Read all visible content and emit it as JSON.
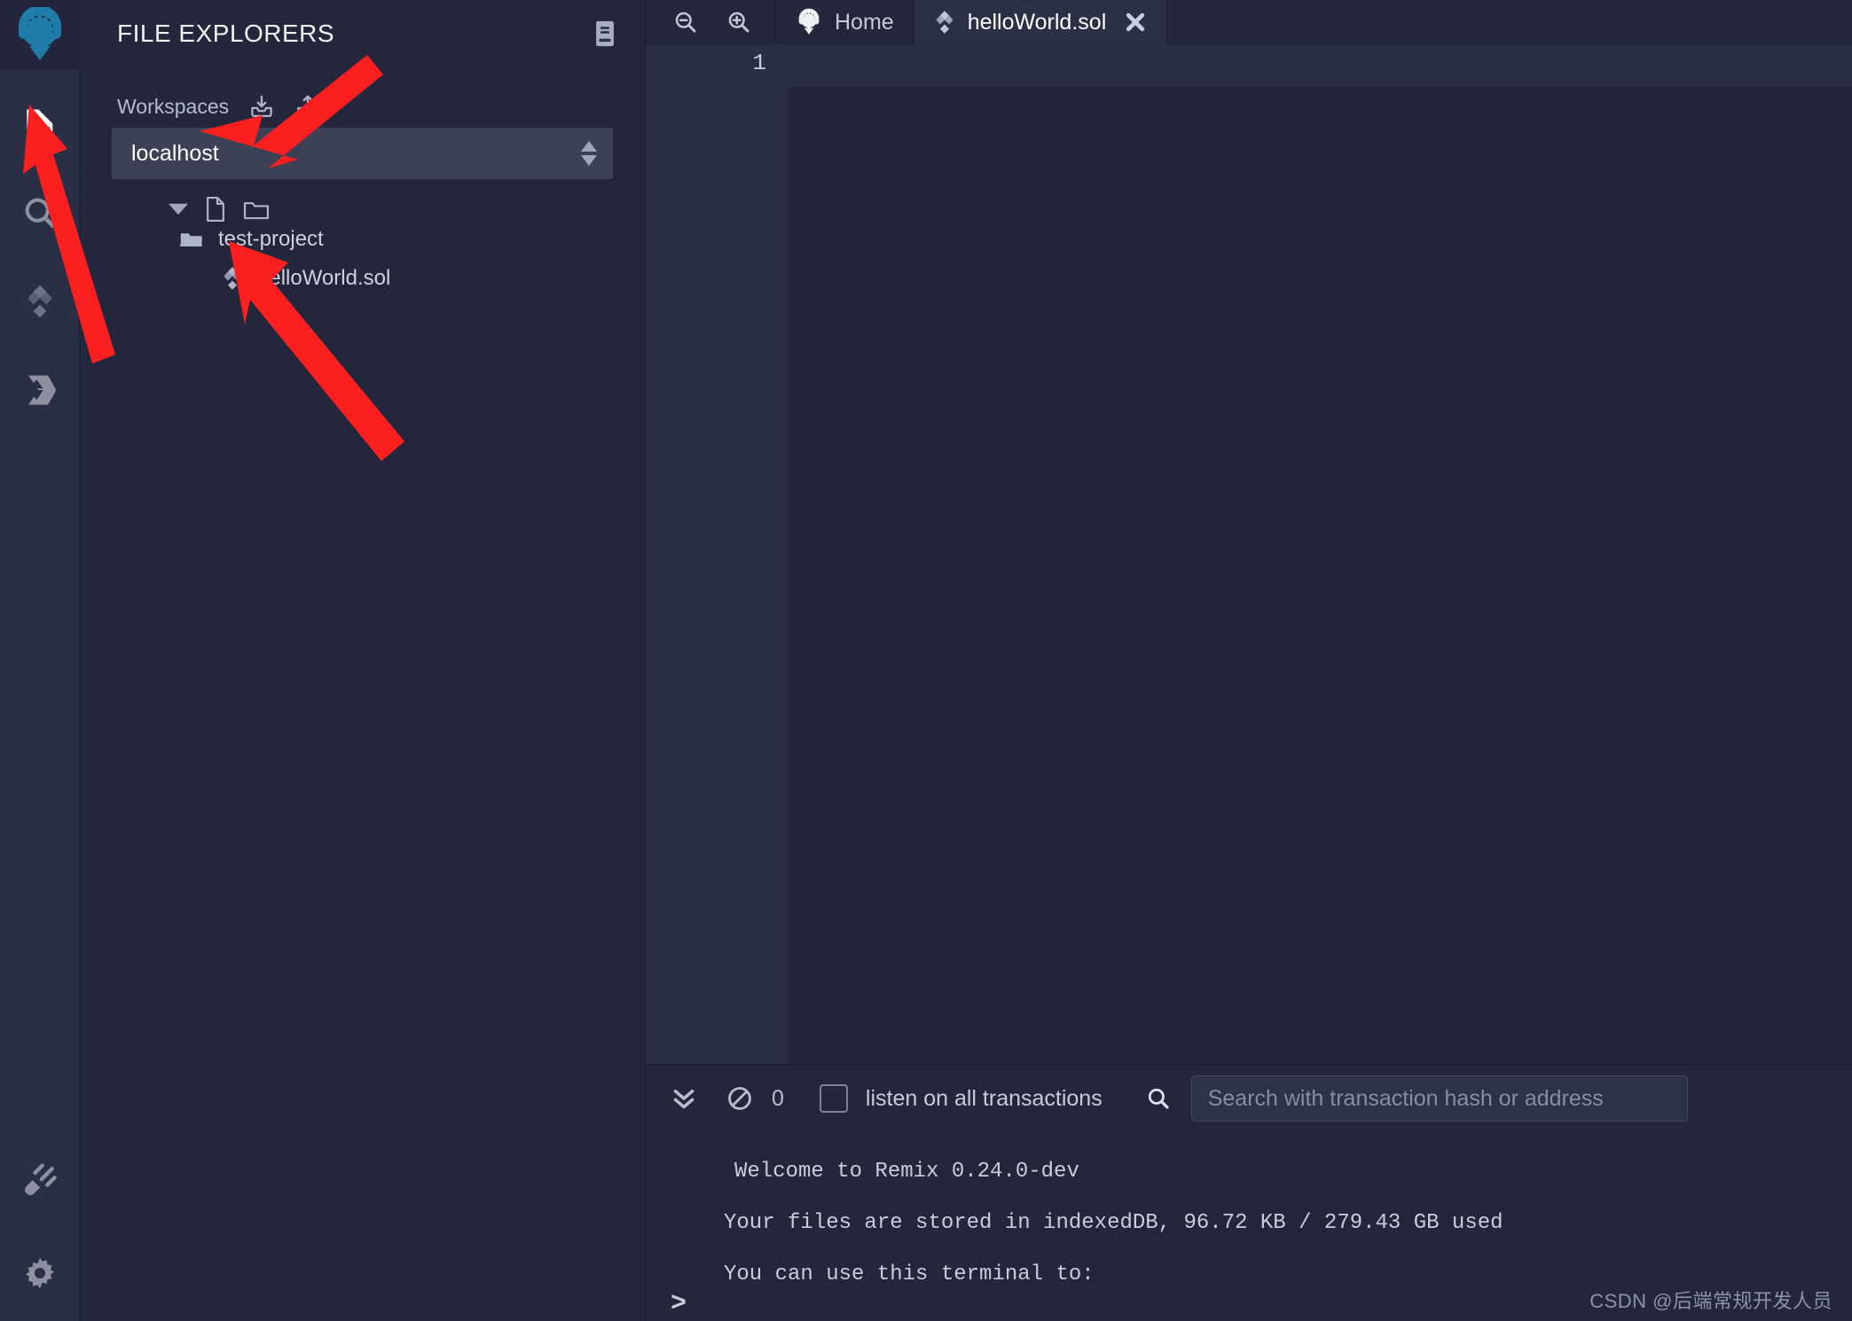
{
  "app": {
    "logo_icon": "remix-logo-icon",
    "logo_color": "#1f7ba8"
  },
  "rail": {
    "items": [
      {
        "name": "file-explorers",
        "icon": "files-icon",
        "active": true
      },
      {
        "name": "search",
        "icon": "search-icon",
        "active": false
      },
      {
        "name": "solidity-compiler",
        "icon": "solidity-icon",
        "active": false
      },
      {
        "name": "deploy-run-transactions",
        "icon": "ethereum-icon",
        "active": false
      }
    ],
    "bottom_items": [
      {
        "name": "plugin-manager",
        "icon": "plug-icon"
      },
      {
        "name": "settings",
        "icon": "gear-icon"
      }
    ]
  },
  "file_panel": {
    "title": "FILE EXPLORERS",
    "header_icon": "book-icon",
    "workspaces_label": "Workspaces",
    "workspace_actions": [
      {
        "name": "import-workspace",
        "icon": "download-inbox-icon"
      },
      {
        "name": "export-workspace",
        "icon": "upload-outbox-icon"
      }
    ],
    "workspace_selected": "localhost",
    "workspace_options": [
      "localhost"
    ],
    "tree_tools": [
      {
        "name": "collapse-all",
        "icon": "caret-down-icon"
      },
      {
        "name": "new-file",
        "icon": "new-file-icon"
      },
      {
        "name": "new-folder",
        "icon": "new-folder-icon"
      }
    ],
    "tree": [
      {
        "name": "test-project",
        "label": "test-project",
        "type": "folder",
        "icon": "folder-open-icon"
      },
      {
        "name": "helloWorld.sol",
        "label": "helloWorld.sol",
        "type": "file",
        "icon": "solidity-file-icon"
      }
    ]
  },
  "editor": {
    "zoom_out_icon": "zoom-out-icon",
    "zoom_in_icon": "zoom-in-icon",
    "tabs": [
      {
        "label": "Home",
        "icon": "remix-home-icon",
        "active": false,
        "closable": false
      },
      {
        "label": "helloWorld.sol",
        "icon": "solidity-file-icon",
        "active": true,
        "closable": true,
        "close_icon": "close-icon"
      }
    ],
    "line_numbers": [
      "1"
    ],
    "content": ""
  },
  "terminal": {
    "toolbar": {
      "collapse_icon": "double-chevron-down-icon",
      "clear_icon": "ban-circle-icon",
      "pending_count": "0",
      "listen_checkbox_label": "listen on all transactions",
      "listen_checked": false,
      "search_icon": "search-icon",
      "search_value": "",
      "search_placeholder": "Search with transaction hash or address"
    },
    "lines": [
      "Welcome to Remix 0.24.0-dev",
      "Your files are stored in indexedDB, 96.72 KB / 279.43 GB used",
      "You can use this terminal to:"
    ],
    "prompt": ">"
  },
  "watermark": "CSDN @后端常规开发人员",
  "annotations": {
    "arrow_color": "#fc1f1f",
    "arrows": [
      {
        "name": "arrow-to-file-explorers-icon",
        "target": "file-explorers rail icon"
      },
      {
        "name": "arrow-to-workspace-select",
        "target": "localhost workspace dropdown"
      },
      {
        "name": "arrow-to-helloworld-file",
        "target": "helloWorld.sol tree item"
      }
    ]
  }
}
